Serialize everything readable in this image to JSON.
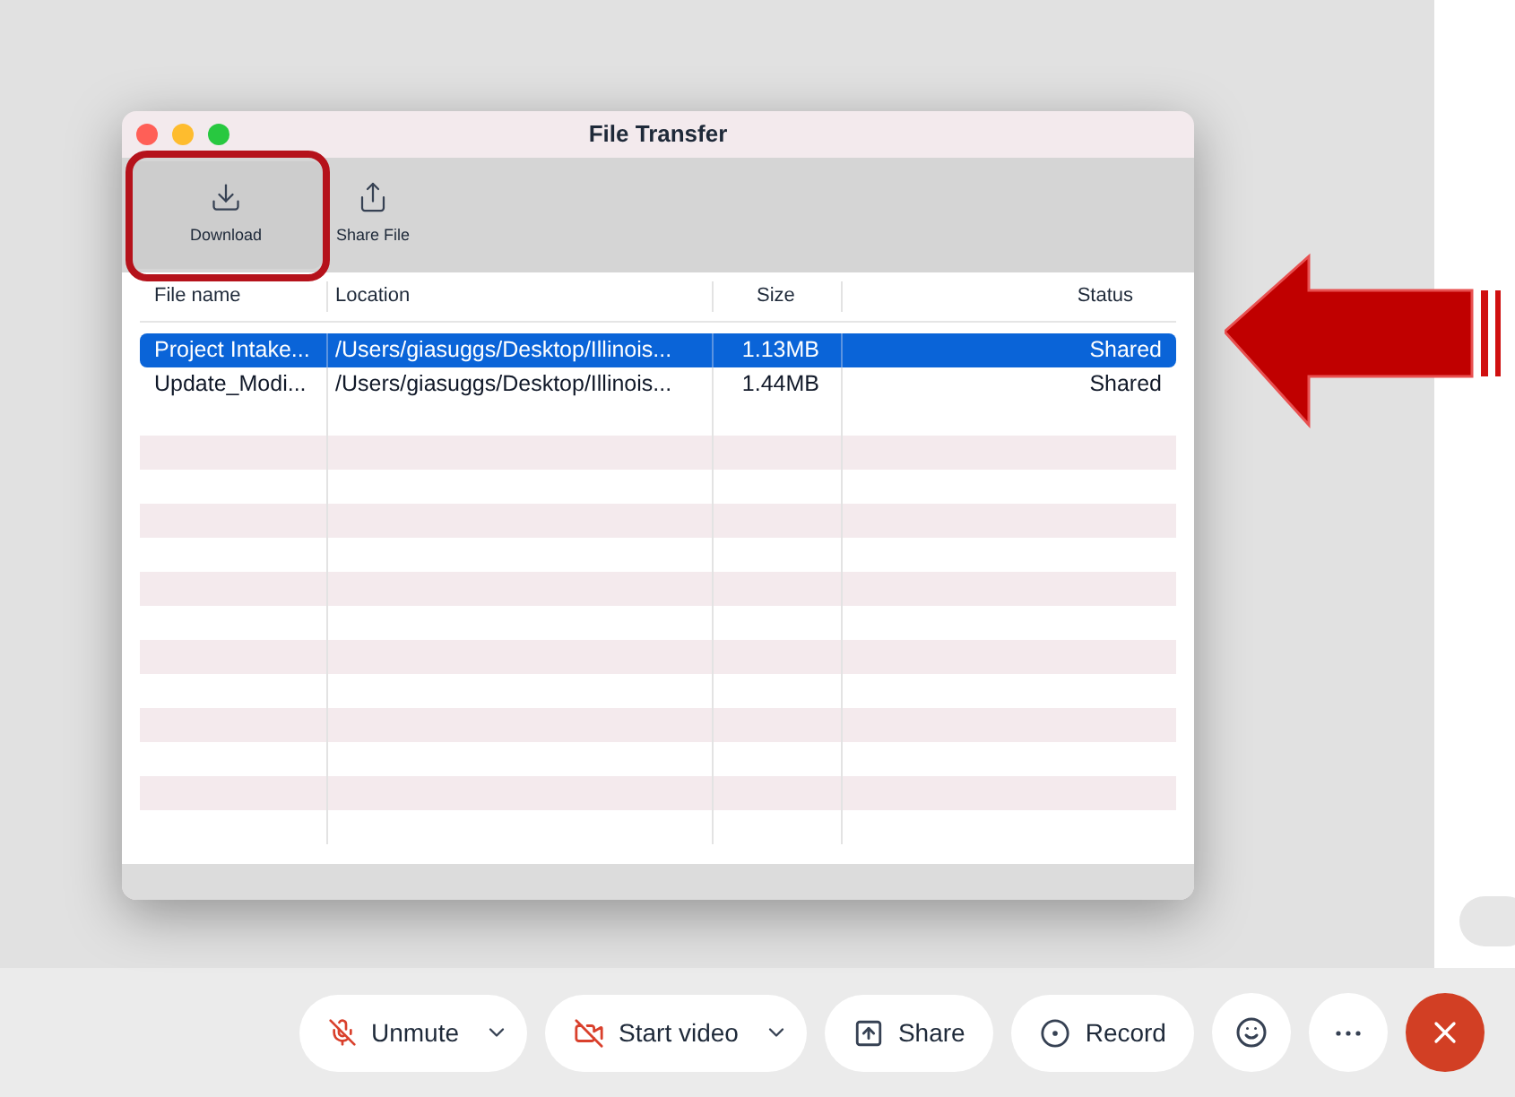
{
  "window": {
    "title": "File Transfer"
  },
  "toolbar": [
    {
      "kind": "download",
      "label": "Download",
      "selected": true
    },
    {
      "kind": "share",
      "label": "Share File",
      "selected": false
    }
  ],
  "table": {
    "columns": [
      "File name",
      "Location",
      "Size",
      "Status"
    ],
    "rows": [
      {
        "cells": [
          "Project Intake...",
          "/Users/giasuggs/Desktop/Illinois...",
          "1.13MB",
          "Shared"
        ],
        "selected": true
      },
      {
        "cells": [
          "Update_Modi...",
          "/Users/giasuggs/Desktop/Illinois...",
          "1.44MB",
          "Shared"
        ],
        "selected": false
      }
    ]
  },
  "controls": [
    {
      "kind": "mic",
      "label": "Unmute",
      "menu": true
    },
    {
      "kind": "video",
      "label": "Start video",
      "menu": true
    },
    {
      "kind": "share",
      "label": "Share",
      "menu": false
    },
    {
      "kind": "record",
      "label": "Record",
      "menu": false
    },
    {
      "kind": "reactions"
    },
    {
      "kind": "more"
    },
    {
      "kind": "end"
    }
  ]
}
